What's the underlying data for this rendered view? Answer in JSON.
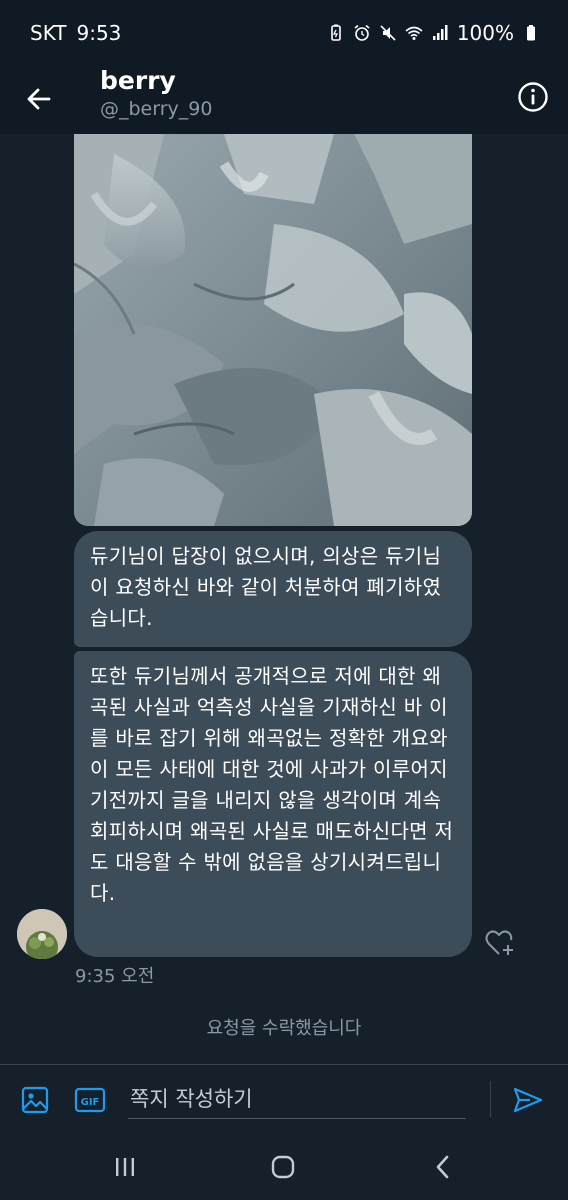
{
  "status_bar": {
    "carrier": "SKT",
    "time": "9:53",
    "battery": "100%"
  },
  "header": {
    "name": "berry",
    "handle": "@_berry_90"
  },
  "messages": [
    {
      "text": "듀기님이 답장이 없으시며, 의상은 듀기님이 요청하신 바와 같이 처분하여 폐기하였습니다."
    },
    {
      "text": "또한 듀기님께서 공개적으로 저에 대한 왜곡된 사실과 억측성 사실을 기재하신 바 이를 바로 잡기 위해 왜곡없는 정확한 개요와 이 모든 사태에 대한 것에 사과가 이루어지기전까지 글을 내리지 않을 생각이며 계속 회피하시며 왜곡된 사실로 매도하신다면 저도 대응할 수 밖에 없음을 상기시켜드립니다."
    }
  ],
  "timestamp": "9:35 오전",
  "system_message": "요청을 수락했습니다",
  "composer": {
    "placeholder": "쪽지 작성하기",
    "gif_label": "GIF"
  },
  "colors": {
    "background": "#15202b",
    "bubble": "#3d4c59",
    "accent": "#1d9bf0",
    "muted_text": "#8b98a5"
  },
  "icons": {
    "back": "arrow-left-icon",
    "info": "info-icon",
    "media": "image-icon",
    "gif": "gif-icon",
    "send": "send-icon",
    "react": "heart-plus-icon"
  }
}
